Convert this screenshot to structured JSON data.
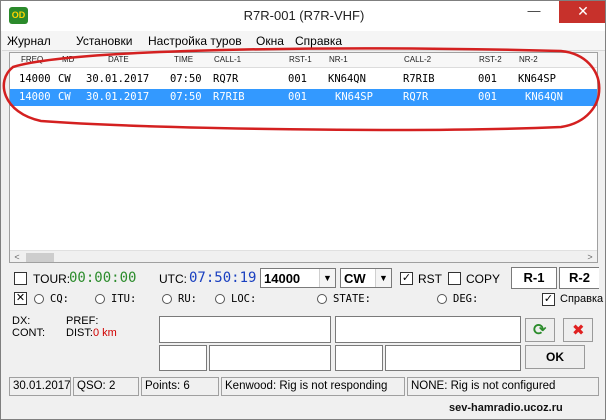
{
  "window": {
    "title": "R7R-001  (R7R-VHF)",
    "icon_text": "OD",
    "minimize_glyph": "—",
    "maximize_glyph": "□",
    "close_glyph": "✕"
  },
  "menu": [
    "Журнал",
    "Установки",
    "Настройка туров",
    "Окна",
    "Справка"
  ],
  "log": {
    "columns": [
      "FREQ",
      "MD",
      "DATE",
      "TIME",
      "CALL-1",
      "RST-1",
      "NR-1",
      "CALL-2",
      "RST-2",
      "NR-2"
    ],
    "rows": [
      {
        "freq": "14000",
        "md": "CW",
        "date": "30.01.2017",
        "time": "07:50",
        "call1": "RQ7R",
        "rst1": "001",
        "nr1": "KN64QN",
        "call2": "R7RIB",
        "rst2": "001",
        "nr2": "KN64SP",
        "selected": false
      },
      {
        "freq": "14000",
        "md": "CW",
        "date": "30.01.2017",
        "time": "07:50",
        "call1": "R7RIB",
        "rst1": "001",
        "nr1": "KN64SP",
        "call2": "RQ7R",
        "rst2": "001",
        "nr2": "KN64QN",
        "selected": true
      }
    ],
    "scroll_left_glyph": "<",
    "scroll_right_glyph": ">"
  },
  "controls": {
    "tour_label": "TOUR:",
    "timer": "00:00:00",
    "utc_label": "UTC:",
    "utc_time": "07:50:19",
    "freq": "14000",
    "mode": "CW",
    "rst_label": "RST",
    "rst_checked": true,
    "copy_label": "COPY",
    "copy_checked": false,
    "r1_label": "R-1",
    "r2_label": "R-2",
    "check_glyph": "✓",
    "dropdown_glyph": "▼"
  },
  "options": {
    "close_glyph": "✕",
    "items": [
      "CQ:",
      "ITU:",
      "RU:",
      "LOC:",
      "STATE:",
      "DEG:"
    ],
    "help_label": "Справка",
    "help_checked": true
  },
  "info": {
    "dx_label": "DX:",
    "pref_label": "PREF:",
    "cont_label": "CONT:",
    "dist_label": "DIST:",
    "dist_value": "0 km",
    "ok_label": "OK",
    "refresh_glyph": "⟳",
    "delete_glyph": "✖"
  },
  "status": {
    "date": "30.01.2017",
    "qso": "QSO: 2",
    "points": "Points: 6",
    "rig1": "Kenwood: Rig is not responding",
    "rig2": "NONE: Rig is not configured"
  },
  "watermark": "sev-hamradio.ucoz.ru",
  "colors": {
    "selection": "#3399ff",
    "timer": "#2c8c2c",
    "utc": "#1a40c0",
    "annotation": "#d42020",
    "dist_value": "#d00000",
    "delete_icon": "#e02020",
    "refresh_icon": "#2c8c2c"
  }
}
